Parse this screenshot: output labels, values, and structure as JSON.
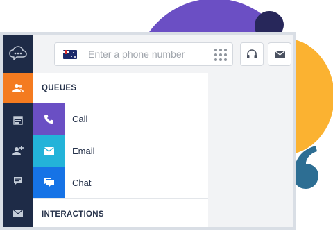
{
  "colors": {
    "rail_bg": "#1e2b47",
    "rail_active": "#f47b20",
    "call": "#6a4fc4",
    "email": "#23b3d9",
    "chat": "#1673e6",
    "deco_purple": "#6b4fc4",
    "deco_orange": "#fbb231",
    "deco_navy": "#27275a",
    "quote": "#2d6e93"
  },
  "rail": {
    "items": [
      {
        "icon": "chat-cloud-icon",
        "active": false
      },
      {
        "icon": "users-icon",
        "active": true
      },
      {
        "icon": "calendar-icon",
        "active": false
      },
      {
        "icon": "add-user-icon",
        "active": false
      },
      {
        "icon": "message-icon",
        "active": false
      },
      {
        "icon": "mail-icon",
        "active": false
      }
    ]
  },
  "topbar": {
    "phone_placeholder": "Enter a phone number",
    "country_flag": "australia-flag-icon",
    "dialpad_icon": "dialpad-icon",
    "headset_icon": "headset-icon",
    "mail_icon": "mail-icon"
  },
  "panel": {
    "queues_heading": "QUEUES",
    "queues": [
      {
        "label": "Call",
        "icon": "phone-icon"
      },
      {
        "label": "Email",
        "icon": "envelope-icon"
      },
      {
        "label": "Chat",
        "icon": "chat-bubbles-icon"
      }
    ],
    "interactions_heading": "INTERACTIONS"
  }
}
